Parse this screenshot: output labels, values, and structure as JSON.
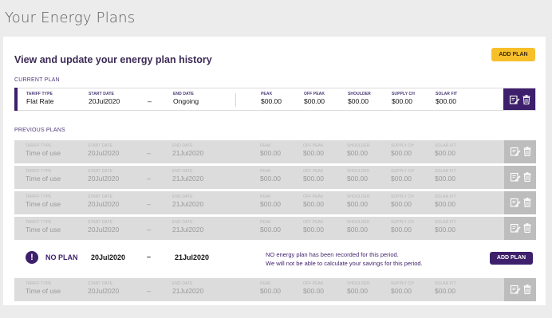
{
  "page_title": "Your Energy Plans",
  "card": {
    "title": "View and update your energy plan history",
    "add_plan_label": "ADD PLAN"
  },
  "labels": {
    "tariff_type": "TARIFF TYPE",
    "start_date": "START DATE",
    "end_date": "END DATE",
    "peak": "PEAK",
    "off_peak": "OFF PEAK",
    "shoulder": "SHOULDER",
    "supply_ch": "SUPPLY CH",
    "solar_fit": "SOLAR FIT",
    "dash": "–"
  },
  "current_section_label": "CURRENT PLAN",
  "previous_section_label": "PREVIOUS PLANS",
  "current_plan": {
    "tariff": "Flat Rate",
    "start": "20Jul2020",
    "end": "Ongoing",
    "peak": "$00.00",
    "off_peak": "$00.00",
    "shoulder": "$00.00",
    "supply": "$00.00",
    "solar": "$00.00"
  },
  "previous_plans": [
    {
      "tariff": "Time of use",
      "start": "20Jul2020",
      "end": "21Jul2020",
      "peak": "$00.00",
      "off_peak": "$00.00",
      "shoulder": "$00.00",
      "supply": "$00.00",
      "solar": "$00.00"
    },
    {
      "tariff": "Time of use",
      "start": "20Jul2020",
      "end": "21Jul2020",
      "peak": "$00.00",
      "off_peak": "$00.00",
      "shoulder": "$00.00",
      "supply": "$00.00",
      "solar": "$00.00"
    },
    {
      "tariff": "Time of use",
      "start": "20Jul2020",
      "end": "21Jul2020",
      "peak": "$00.00",
      "off_peak": "$00.00",
      "shoulder": "$00.00",
      "supply": "$00.00",
      "solar": "$00.00"
    },
    {
      "tariff": "Time of use",
      "start": "20Jul2020",
      "end": "21Jul2020",
      "peak": "$00.00",
      "off_peak": "$00.00",
      "shoulder": "$00.00",
      "supply": "$00.00",
      "solar": "$00.00"
    },
    {
      "tariff": "Time of use",
      "start": "20Jul2020",
      "end": "21Jul2020",
      "peak": "$00.00",
      "off_peak": "$00.00",
      "shoulder": "$00.00",
      "supply": "$00.00",
      "solar": "$00.00"
    }
  ],
  "no_plan": {
    "icon": "!",
    "label": "NO PLAN",
    "start": "20Jul2020",
    "end": "21Jul2020",
    "message_line1": "NO energy plan has been recorded for this period.",
    "message_line2": "We will not be able to calculate your savings for this period.",
    "add_plan_label": "ADD PLAN"
  },
  "icons": {
    "edit": "edit-icon",
    "delete": "trash-icon"
  },
  "colors": {
    "brand_purple": "#3d1f6b",
    "accent_yellow": "#f7c02b",
    "prev_row_bg": "#dcdcdc",
    "page_bg": "#ececec"
  }
}
